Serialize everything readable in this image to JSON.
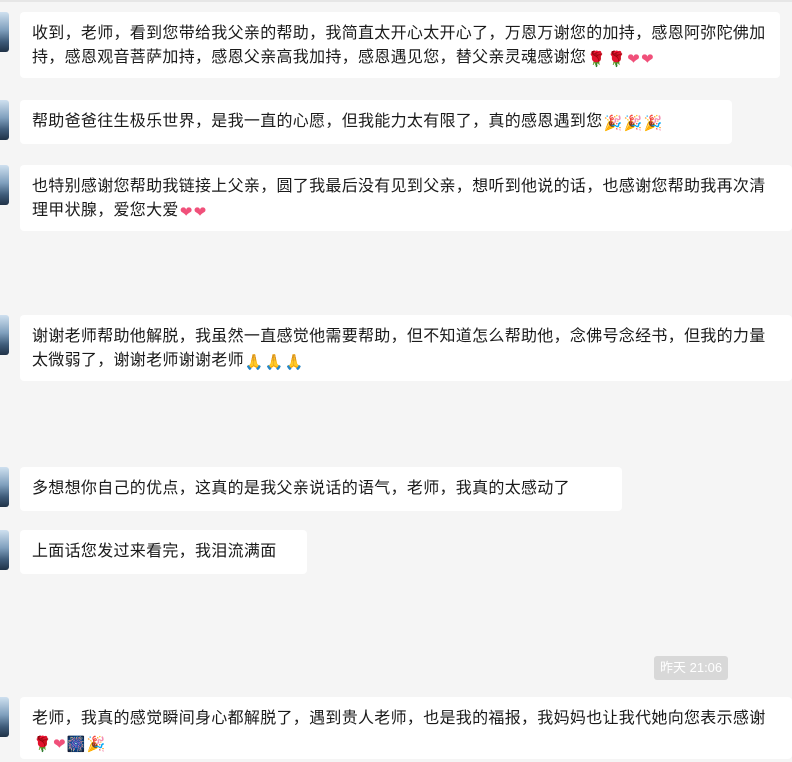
{
  "messages": [
    {
      "text": "收到，老师，看到您带给我父亲的帮助，我简直太开心太开心了，万恩万谢您的加持，感恩阿弥陀佛加持，感恩观音菩萨加持，感恩父亲高我加持，感恩遇见您，替父亲灵魂感谢您",
      "emojis": [
        "rose-icon",
        "rose-icon",
        "heart-icon",
        "heart-icon"
      ]
    },
    {
      "text": "帮助爸爸往生极乐世界，是我一直的心愿，但我能力太有限了，真的感恩遇到您",
      "emojis": [
        "party-popper-icon",
        "party-popper-icon",
        "party-popper-icon"
      ]
    },
    {
      "text": "也特别感谢您帮助我链接上父亲，圆了我最后没有见到父亲，想听到他说的话，也感谢您帮助我再次清理甲状腺，爱您大爱",
      "emojis": [
        "heart-icon",
        "heart-icon"
      ]
    },
    {
      "text": "谢谢老师帮助他解脱，我虽然一直感觉他需要帮助，但不知道怎么帮助他，念佛号念经书，但我的力量太微弱了，谢谢老师谢谢老师",
      "emojis": [
        "pray-icon",
        "pray-icon",
        "pray-icon"
      ]
    },
    {
      "text": "多想想你自己的优点，这真的是我父亲说话的语气，老师，我真的太感动了",
      "emojis": []
    },
    {
      "text": "上面话您发过来看完，我泪流满面",
      "emojis": []
    },
    {
      "text": "老师，我真的感觉瞬间身心都解脱了，遇到贵人老师，也是我的福报，我妈妈也让我代她向您表示感谢",
      "emojis": [
        "rose-icon",
        "heart-icon",
        "firework-icon",
        "party-popper-icon"
      ]
    }
  ],
  "timestamp": "昨天 21:06",
  "colors": {
    "background": "#f5f5f5",
    "bubble": "#ffffff",
    "timestamp_pill": "#d8d8d8"
  }
}
